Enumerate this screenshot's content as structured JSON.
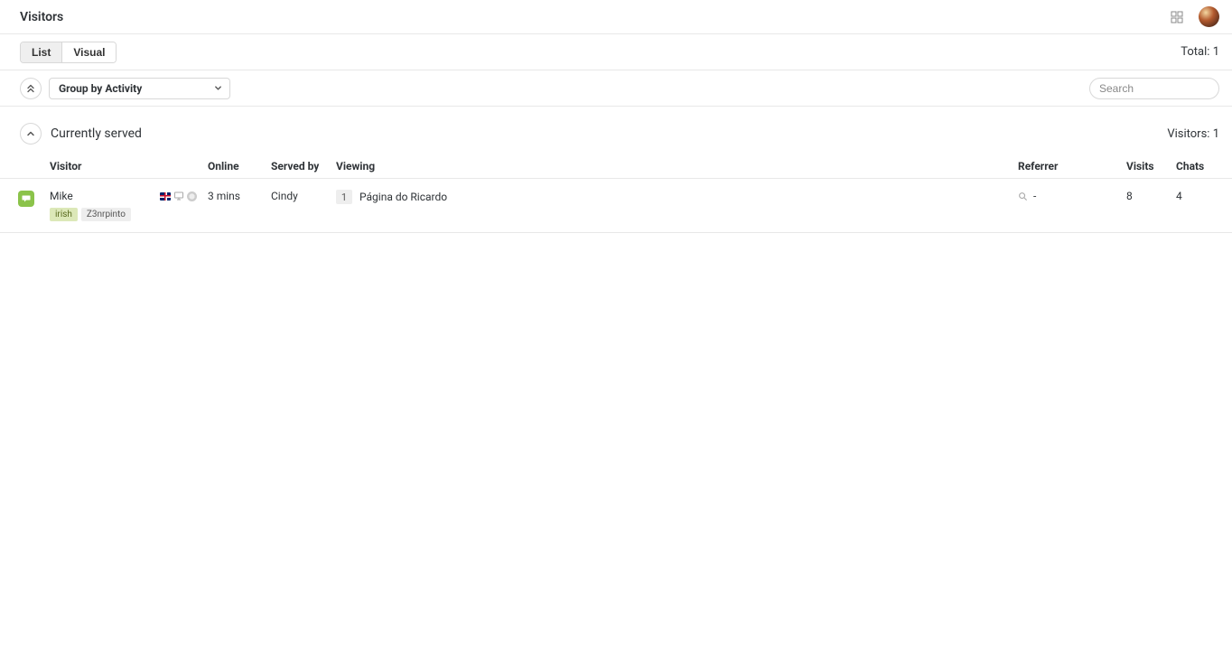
{
  "header": {
    "title": "Visitors"
  },
  "viewTabs": {
    "list": "List",
    "visual": "Visual",
    "active": "list"
  },
  "total": {
    "label": "Total:",
    "value": "1"
  },
  "filters": {
    "groupBy": "Group by Activity",
    "searchPlaceholder": "Search"
  },
  "section": {
    "title": "Currently served",
    "countLabel": "Visitors:",
    "countValue": "1"
  },
  "columns": {
    "visitor": "Visitor",
    "online": "Online",
    "servedBy": "Served by",
    "viewing": "Viewing",
    "referrer": "Referrer",
    "visits": "Visits",
    "chats": "Chats"
  },
  "rows": [
    {
      "name": "Mike",
      "tags": [
        {
          "text": "irish",
          "variant": "green"
        },
        {
          "text": "Z3nrpinto",
          "variant": ""
        }
      ],
      "online": "3 mins",
      "servedBy": "Cindy",
      "viewingCount": "1",
      "viewingPage": "Página do Ricardo",
      "referrer": "-",
      "visits": "8",
      "chats": "4"
    }
  ]
}
